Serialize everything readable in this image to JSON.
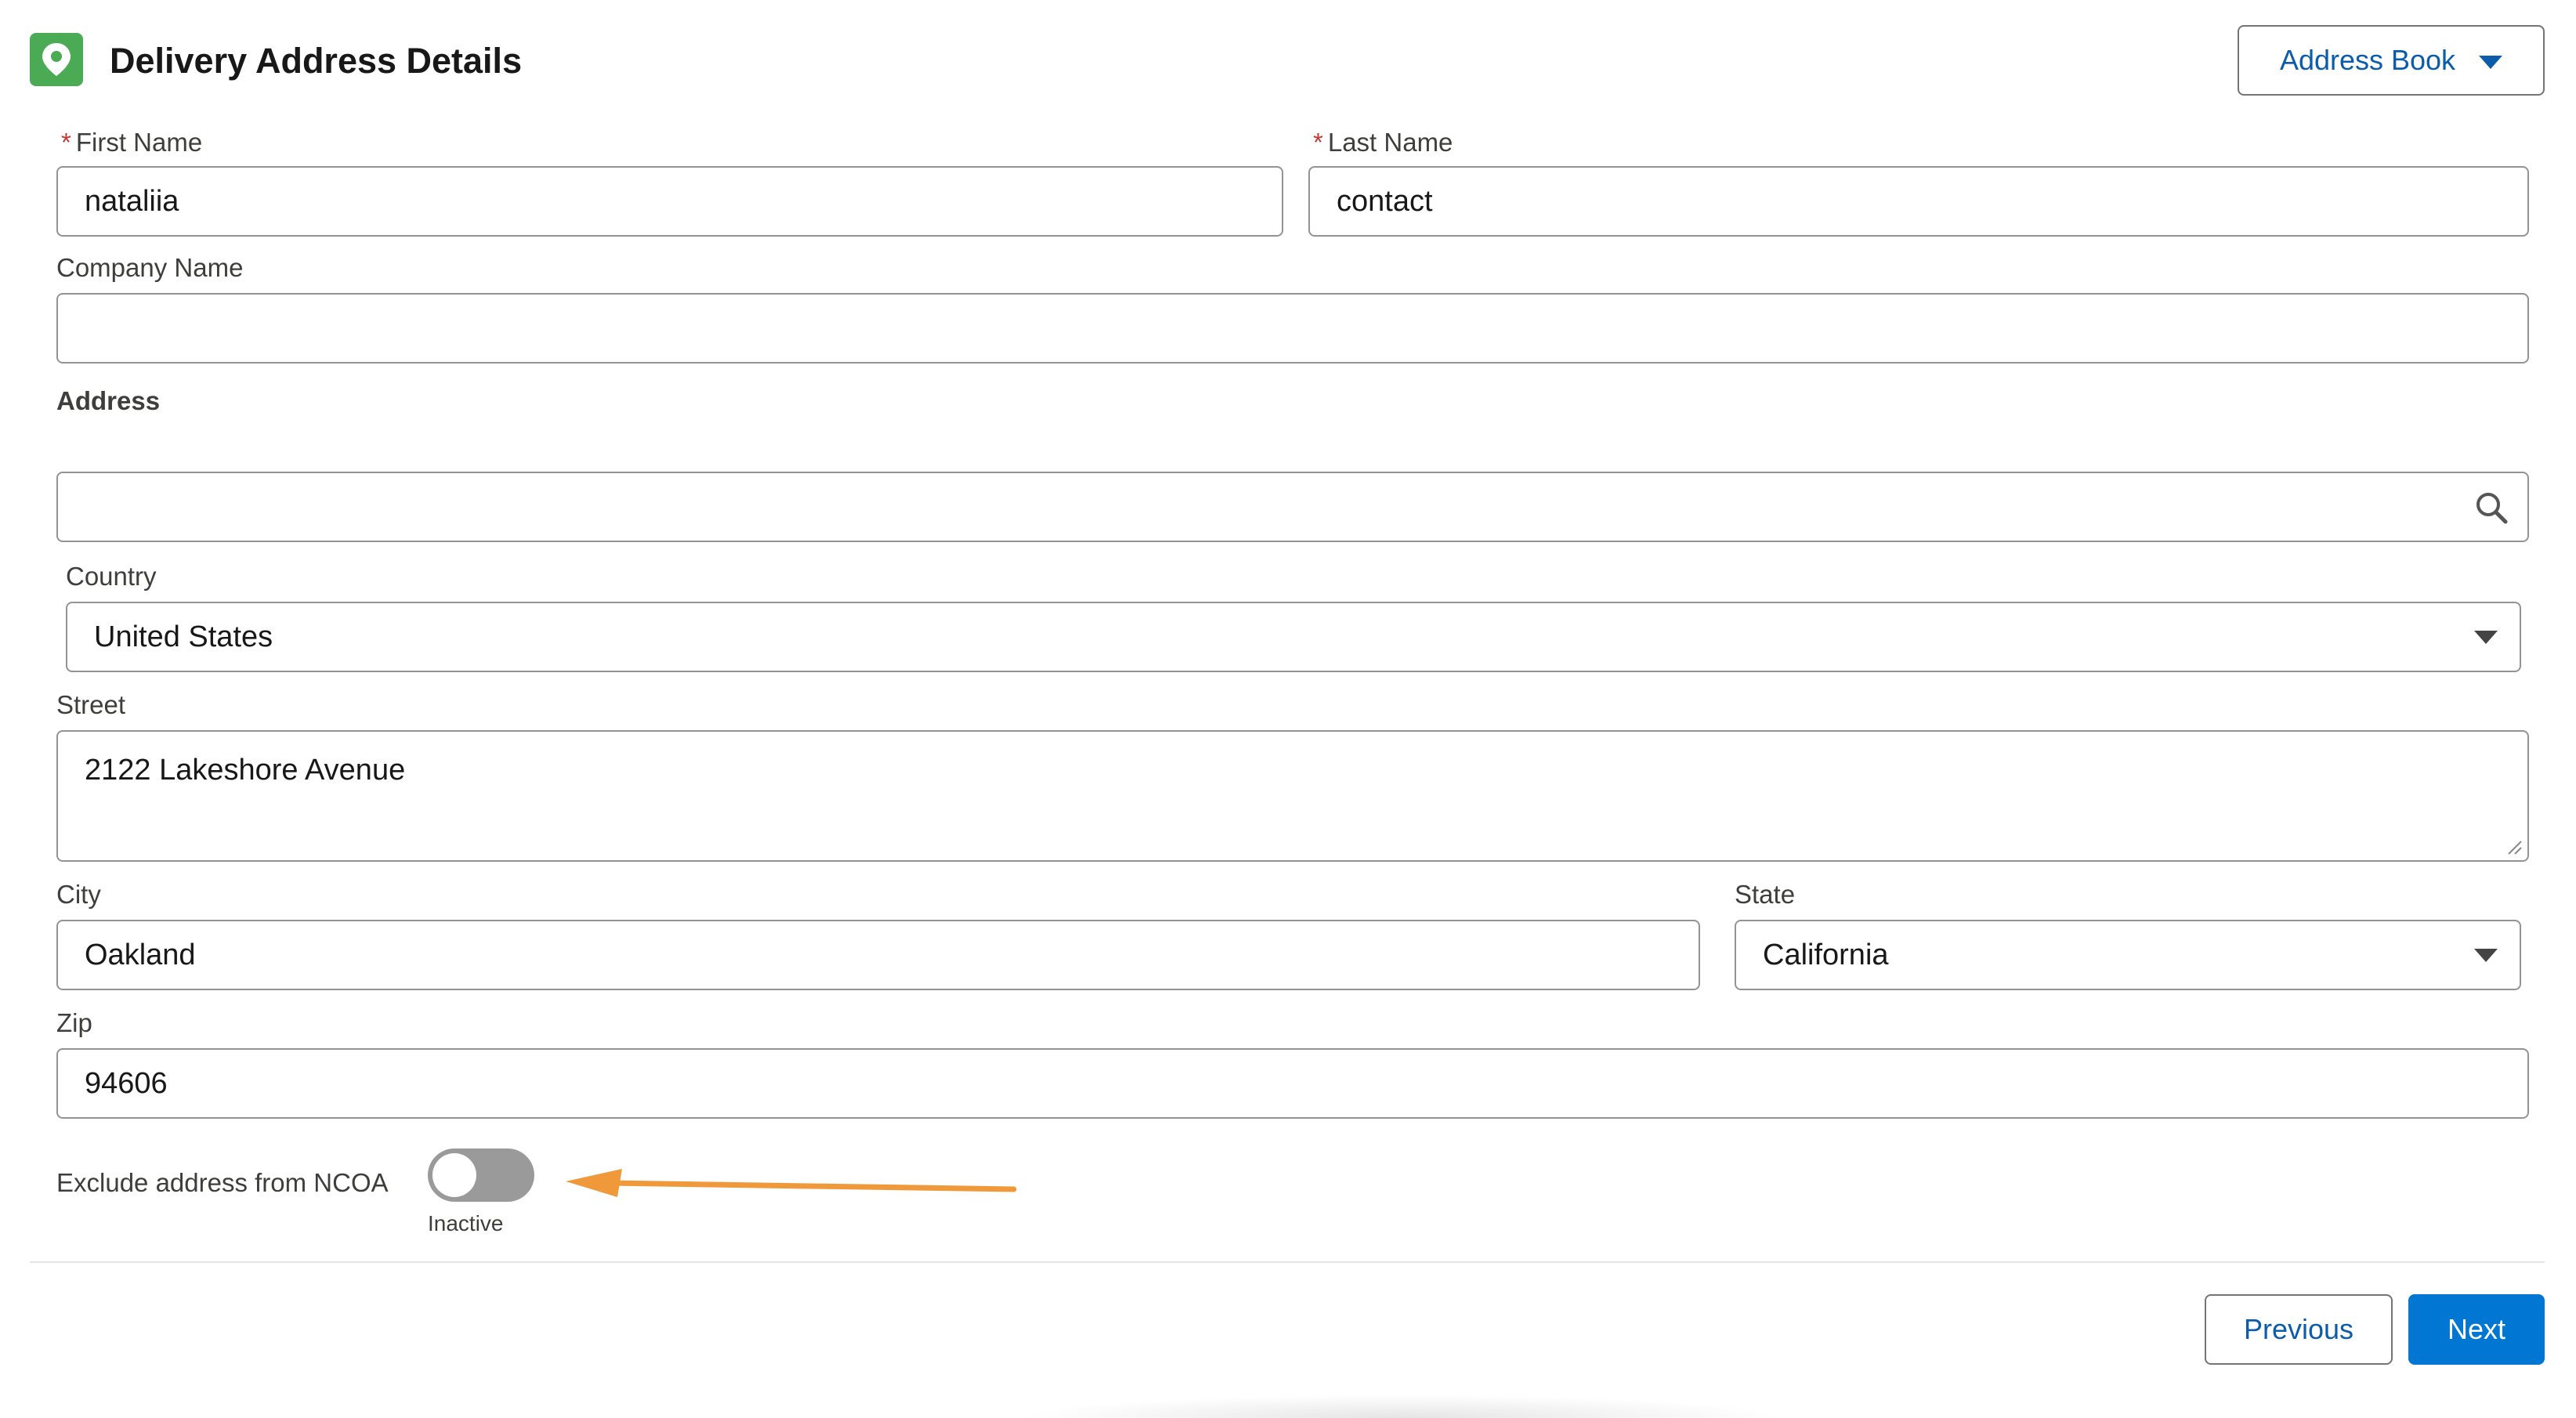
{
  "header": {
    "title": "Delivery Address Details",
    "icon": "map-pin-icon",
    "icon_bg": "#4bab54",
    "address_book_label": "Address Book"
  },
  "fields": {
    "first_name": {
      "label": "First Name",
      "required_mark": "*",
      "value": "nataliia"
    },
    "last_name": {
      "label": "Last Name",
      "required_mark": "*",
      "value": "contact"
    },
    "company_name": {
      "label": "Company Name",
      "value": ""
    },
    "address_section_label": "Address",
    "address_search": {
      "value": ""
    },
    "country": {
      "label": "Country",
      "value": "United States"
    },
    "street": {
      "label": "Street",
      "value": "2122 Lakeshore Avenue"
    },
    "city": {
      "label": "City",
      "value": "Oakland"
    },
    "state": {
      "label": "State",
      "value": "California"
    },
    "zip": {
      "label": "Zip",
      "value": "94606"
    }
  },
  "ncoa_toggle": {
    "label": "Exclude address from NCOA",
    "state_text": "Inactive",
    "active": false
  },
  "annotation": {
    "arrow_color": "#f0993a"
  },
  "footer": {
    "previous_label": "Previous",
    "next_label": "Next"
  },
  "colors": {
    "brand_blue": "#0176d3",
    "link_blue": "#0b5cab",
    "required_red": "#c23934"
  }
}
